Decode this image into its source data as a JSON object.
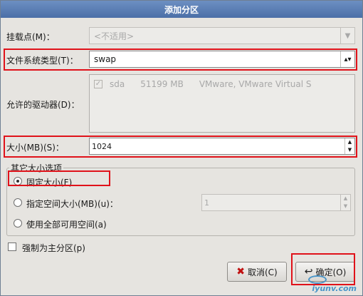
{
  "window": {
    "title": "添加分区"
  },
  "mount_point": {
    "label": "挂载点(M)：",
    "value": "<不适用>"
  },
  "fs_type": {
    "label": "文件系统类型(T)：",
    "value": "swap"
  },
  "drives": {
    "label": "允许的驱动器(D)：",
    "columns": [
      "sda",
      "51199 MB",
      "VMware, VMware Virtual S"
    ],
    "checked": true
  },
  "size": {
    "label": "大小(MB)(S)：",
    "value": "1024"
  },
  "size_options": {
    "title": "其它大小选项",
    "fixed": {
      "label": "固定大小(F)",
      "selected": true
    },
    "fill_to": {
      "label": "指定空间大小(MB)(u)：",
      "value": "1",
      "selected": false
    },
    "fill_all": {
      "label": "使用全部可用空间(a)",
      "selected": false
    }
  },
  "force_primary": {
    "label": "强制为主分区(p)",
    "checked": false
  },
  "buttons": {
    "cancel": "取消(C)",
    "ok": "确定(O)"
  },
  "watermark": "iyunv.com",
  "accent_color": "#e0121a"
}
